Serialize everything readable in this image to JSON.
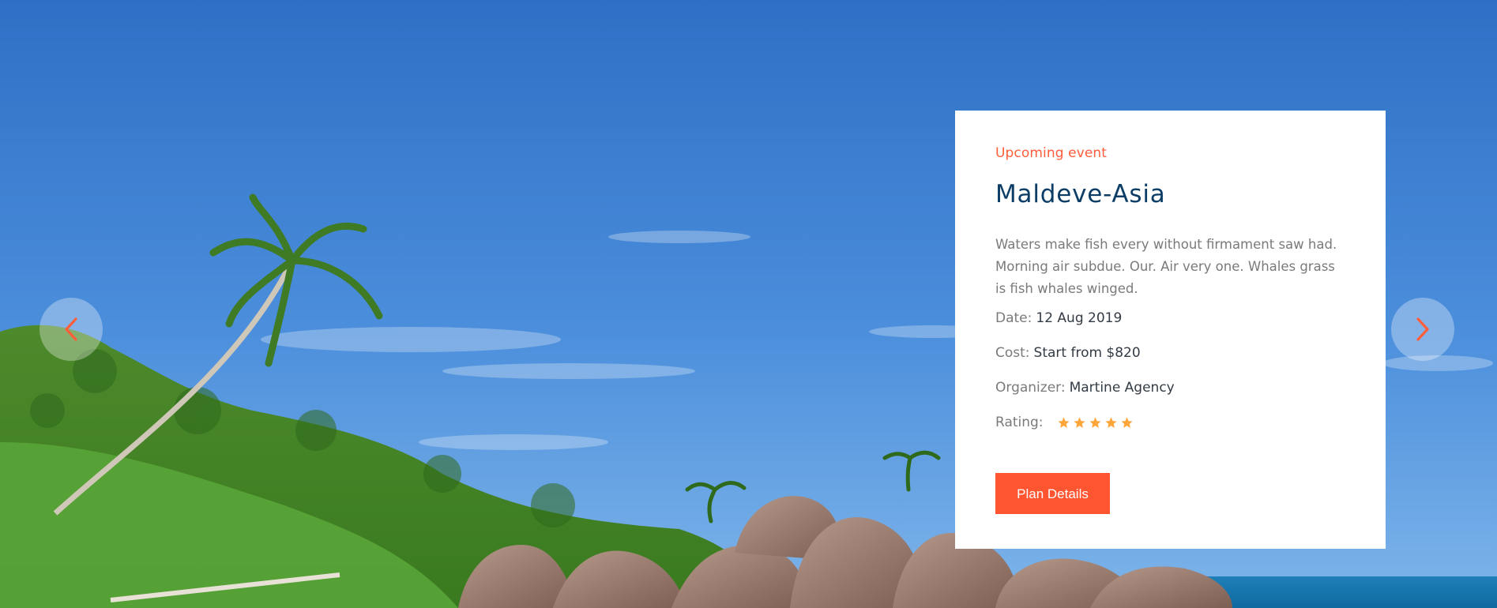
{
  "slider": {
    "prev_icon": "chevron-left-icon",
    "next_icon": "chevron-right-icon",
    "accent_color": "#ff5e3a"
  },
  "event": {
    "eyebrow": "Upcoming event",
    "title": "Maldeve-Asia",
    "description": "Waters make fish every without firmament saw had. Morning air subdue. Our. Air very one. Whales grass is fish whales winged.",
    "date_label": "Date:",
    "date_value": "12 Aug 2019",
    "cost_label": "Cost:",
    "cost_value": "Start from $820",
    "organizer_label": "Organizer:",
    "organizer_value": "Martine Agency",
    "rating_label": "Rating:",
    "rating_value": 5,
    "rating_max": 5,
    "rating_color": "#ffa63a",
    "button_label": "Plan Details"
  }
}
